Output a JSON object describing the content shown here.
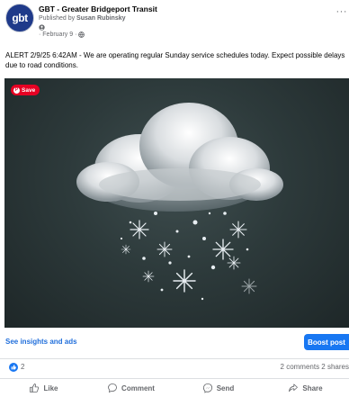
{
  "page": {
    "avatar_text": "gbt",
    "name": "GBT - Greater Bridgeport Transit",
    "published_prefix": "Published by",
    "author": "Susan Rubinsky",
    "date": "· February 9 ·",
    "more_icon": "ellipsis-icon"
  },
  "post": {
    "text": "ALERT 2/9/25 6:42AM - We are operating regular Sunday service schedules today. Expect possible delays due to road conditions.",
    "save_label": "Save"
  },
  "insights": {
    "link_label": "See insights and ads",
    "boost_label": "Boost post"
  },
  "stats": {
    "like_count": "2",
    "summary": "2 comments  2 shares"
  },
  "actions": {
    "like": "Like",
    "comment": "Comment",
    "send": "Send",
    "share": "Share"
  },
  "colors": {
    "accent": "#1877f2",
    "link": "#216fdb",
    "pinterest": "#e60023"
  }
}
